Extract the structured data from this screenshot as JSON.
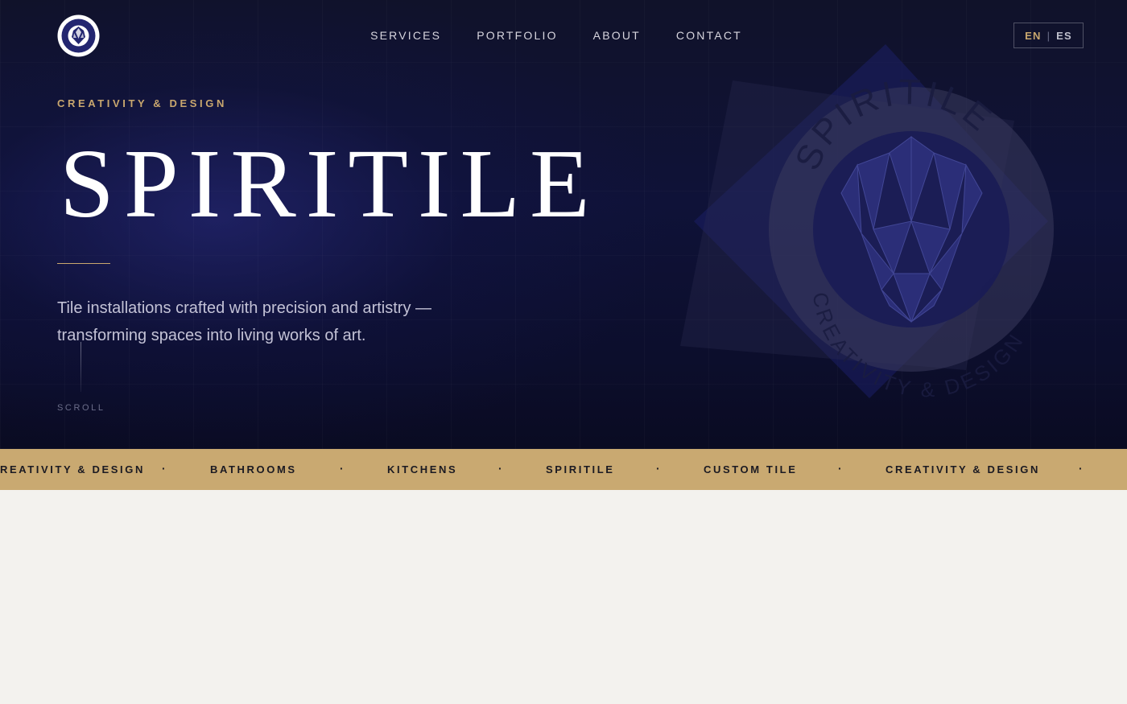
{
  "brand": {
    "name": "SPIRITILE",
    "emblem_text_top": "SPIRITILE",
    "emblem_text_bottom": "CREATIVITY & DESIGN",
    "logo_icon": "lion-emblem-icon"
  },
  "nav": {
    "items": [
      {
        "label": "SERVICES"
      },
      {
        "label": "PORTFOLIO"
      },
      {
        "label": "ABOUT"
      },
      {
        "label": "CONTACT"
      }
    ],
    "lang": {
      "active": "EN",
      "separator": "|",
      "other": "ES"
    }
  },
  "hero": {
    "eyebrow": "CREATIVITY & DESIGN",
    "title": "SPIRITILE",
    "tagline": "Tile installations crafted with precision and artistry — transforming spaces into living works of art.",
    "scroll_label": "SCROLL"
  },
  "marquee": {
    "items": [
      "CREATIVITY & DESIGN",
      "BATHROOMS",
      "KITCHENS",
      "SPIRITILE",
      "CUSTOM TILE",
      "CREATIVITY & DESIGN"
    ],
    "separator": "·"
  },
  "colors": {
    "accent_gold": "#c9a76e",
    "marquee_bg": "#c9a971",
    "hero_bg": "#0f1238",
    "page_bg": "#f3f2ee"
  }
}
